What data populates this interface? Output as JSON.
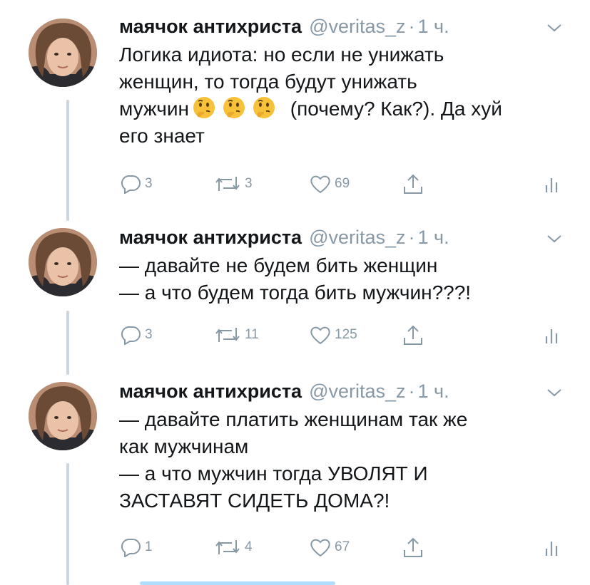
{
  "tweets": [
    {
      "name": "маячок антихриста",
      "handle": "@veritas_z",
      "dot": "·",
      "time": "1 ч.",
      "lines": [
        "Логика идиота: но если не унижать",
        "женщин, то тогда будут унижать",
        "мужчин",
        "(почему? Как?). Да хуй",
        "его знает"
      ],
      "emoji": [
        "thinking-face",
        "thinking-face",
        "thinking-face"
      ],
      "replies": "3",
      "retweets": "3",
      "likes": "69"
    },
    {
      "name": "маячок антихриста",
      "handle": "@veritas_z",
      "dot": "·",
      "time": "1 ч.",
      "lines": [
        "— давайте не будем бить женщин",
        "— а что будем тогда бить мужчин???!"
      ],
      "replies": "3",
      "retweets": "11",
      "likes": "125"
    },
    {
      "name": "маячок антихриста",
      "handle": "@veritas_z",
      "dot": "·",
      "time": "1 ч.",
      "lines": [
        "— давайте платить женщинам так же",
        "как мужчинам",
        "— а что мужчин тогда УВОЛЯТ И",
        "ЗАСТАВЯТ СИДЕТЬ ДОМА?!"
      ],
      "replies": "1",
      "retweets": "4",
      "likes": "67"
    }
  ],
  "icons": {
    "reply": "reply-icon",
    "retweet": "retweet-icon",
    "like": "heart-icon",
    "share": "share-icon",
    "analytics": "analytics-icon",
    "caret": "chevron-down-icon"
  },
  "colors": {
    "text": "#14171a",
    "muted": "#8899a6",
    "thread_line": "#ccd6dd",
    "accent": "#1da1f2"
  }
}
